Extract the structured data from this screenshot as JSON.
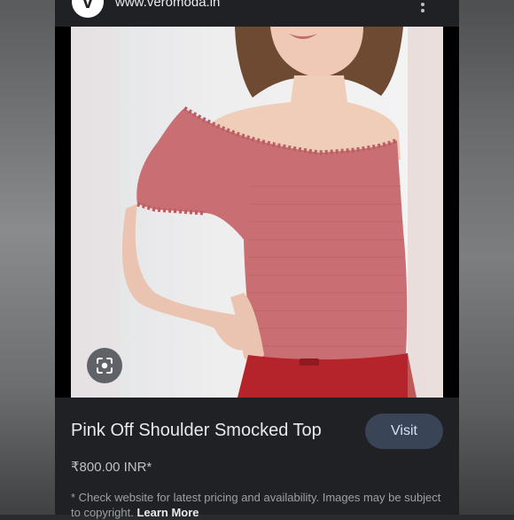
{
  "site": {
    "logo_letter": "V",
    "domain": "www.veromoda.in"
  },
  "image": {
    "icon": "google-lens-icon"
  },
  "product": {
    "title": "Pink Off Shoulder Smocked Top",
    "price": "₹800.00 INR*",
    "visit_label": "Visit"
  },
  "disclaimer": {
    "text": "* Check website for latest pricing and availability. Images may be subject to copyright.",
    "link_label": "Learn More"
  },
  "colors": {
    "background": "#202124",
    "visit_button": "#394457",
    "product": "#c96e72",
    "skirt": "#b5242a"
  }
}
